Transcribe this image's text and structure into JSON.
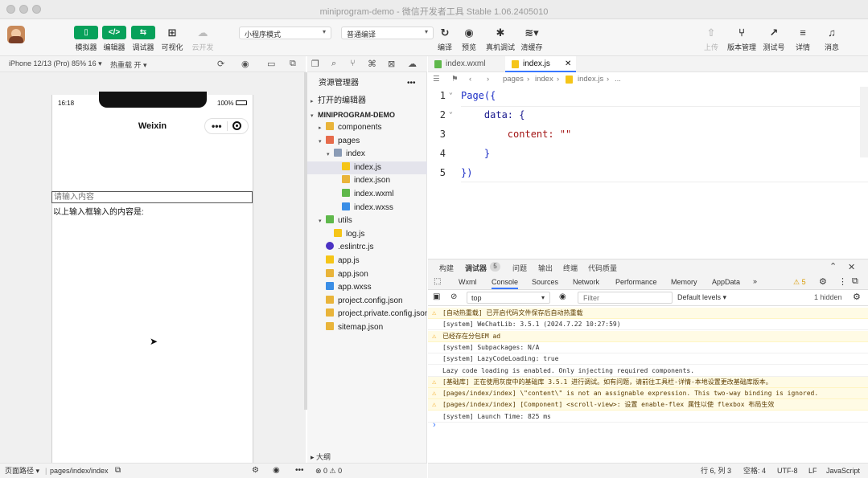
{
  "window": {
    "title": "miniprogram-demo - 微信开发者工具 Stable 1.06.2405010"
  },
  "toolbar": {
    "left_buttons": [
      {
        "label": "模拟器",
        "icon": "phone-icon"
      },
      {
        "label": "编辑器",
        "icon": "code-icon"
      },
      {
        "label": "调试器",
        "icon": "debug-icon"
      },
      {
        "label": "可视化",
        "icon": "layout-icon"
      },
      {
        "label": "云开发",
        "icon": "cloud-icon"
      }
    ],
    "mode_select": "小程序模式",
    "compile_select": "普通编译",
    "mid_buttons": [
      {
        "label": "编译",
        "icon": "refresh-icon"
      },
      {
        "label": "预览",
        "icon": "eye-icon"
      },
      {
        "label": "真机调试",
        "icon": "bug-icon"
      },
      {
        "label": "清缓存",
        "icon": "layers-icon"
      }
    ],
    "right_buttons": [
      {
        "label": "上传",
        "icon": "upload-icon"
      },
      {
        "label": "版本管理",
        "icon": "branch-icon"
      },
      {
        "label": "测试号",
        "icon": "chart-icon"
      },
      {
        "label": "详情",
        "icon": "menu-icon"
      },
      {
        "label": "消息",
        "icon": "bell-icon"
      }
    ]
  },
  "simulator": {
    "device": "iPhone 12/13 (Pro) 85% 16 ▾",
    "hot_reload": "热重载 开 ▾",
    "time": "16:18",
    "battery": "100%",
    "nav_title": "Weixin",
    "input_placeholder": "请输入内容",
    "output_text": "以上输入框输入的内容是:",
    "page_path_label": "页面路径 ▾",
    "page_path": "pages/index/index"
  },
  "explorer": {
    "title": "资源管理器",
    "open_editors": "打开的编辑器",
    "project": "MINIPROGRAM-DEMO",
    "items": [
      {
        "name": "components",
        "arrow": "▸",
        "icon": "folder",
        "color": "#e9b43a"
      },
      {
        "name": "pages",
        "arrow": "▾",
        "icon": "folder",
        "color": "#e66b4b"
      },
      {
        "name": "index",
        "arrow": "▾",
        "icon": "folder",
        "color": "#8a9bb5"
      },
      {
        "name": "index.js",
        "arrow": "",
        "icon": "js",
        "color": "#f5c518"
      },
      {
        "name": "index.json",
        "arrow": "",
        "icon": "json",
        "color": "#e9b43a"
      },
      {
        "name": "index.wxml",
        "arrow": "",
        "icon": "wxml",
        "color": "#5fb84b"
      },
      {
        "name": "index.wxss",
        "arrow": "",
        "icon": "wxss",
        "color": "#3a8ee6"
      },
      {
        "name": "utils",
        "arrow": "▾",
        "icon": "folder",
        "color": "#5fb84b"
      },
      {
        "name": "log.js",
        "arrow": "",
        "icon": "js",
        "color": "#f5c518"
      },
      {
        "name": ".eslintrc.js",
        "arrow": "",
        "icon": "eslint",
        "color": "#4b32c3"
      },
      {
        "name": "app.js",
        "arrow": "",
        "icon": "js",
        "color": "#f5c518"
      },
      {
        "name": "app.json",
        "arrow": "",
        "icon": "json",
        "color": "#e9b43a"
      },
      {
        "name": "app.wxss",
        "arrow": "",
        "icon": "wxss",
        "color": "#3a8ee6"
      },
      {
        "name": "project.config.json",
        "arrow": "",
        "icon": "json",
        "color": "#e9b43a"
      },
      {
        "name": "project.private.config.json",
        "arrow": "",
        "icon": "json",
        "color": "#e9b43a"
      },
      {
        "name": "sitemap.json",
        "arrow": "",
        "icon": "json",
        "color": "#e9b43a"
      }
    ],
    "outline": "大纲",
    "counts": "⊗ 0 ⚠ 0"
  },
  "editor": {
    "tabs": [
      {
        "name": "index.wxml",
        "icon": "wxml"
      },
      {
        "name": "index.js",
        "icon": "js"
      }
    ],
    "breadcrumb": [
      "pages",
      "index",
      "index.js",
      "..."
    ],
    "lines": [
      {
        "num": "1",
        "text": "Page({"
      },
      {
        "num": "2",
        "text": "    data: {"
      },
      {
        "num": "3",
        "text": "        content: \"\""
      },
      {
        "num": "4",
        "text": "    }"
      },
      {
        "num": "5",
        "text": "})"
      }
    ],
    "status": {
      "position": "行 6, 列 3",
      "spaces": "空格: 4",
      "encoding": "UTF-8",
      "eol": "LF",
      "language": "JavaScript"
    }
  },
  "debugger": {
    "top_tabs": [
      "构建",
      "调试器",
      "问题",
      "输出",
      "终端",
      "代码质量"
    ],
    "badge": "5",
    "dev_tabs": [
      "Wxml",
      "Console",
      "Sources",
      "Network",
      "Performance",
      "Memory",
      "AppData",
      "»"
    ],
    "warnings": "⚠ 5",
    "context": "top",
    "filter_placeholder": "Filter",
    "levels": "Default levels ▾",
    "hidden": "1 hidden",
    "logs": [
      {
        "type": "warn",
        "text": "[自动热重载] 已开启代码文件保存后自动热重载"
      },
      {
        "type": "info",
        "text": "[system] WeChatLib: 3.5.1 (2024.7.22 10:27:59)"
      },
      {
        "type": "warn",
        "text": "已经存在分包EM ad"
      },
      {
        "type": "info",
        "text": "[system] Subpackages: N/A"
      },
      {
        "type": "info",
        "text": "[system] LazyCodeLoading: true"
      },
      {
        "type": "info",
        "text": "Lazy code loading is enabled. Only injecting required components."
      },
      {
        "type": "warn",
        "text": "[基础库] 正在使用灰度中的基础库 3.5.1 进行调试。如有问题，请前往工具栏-详情-本地设置更改基础库版本。"
      },
      {
        "type": "warn",
        "text": "[pages/index/index] \\\"content\\\" is not an assignable expression. This two-way binding is ignored."
      },
      {
        "type": "warn",
        "text": "[pages/index/index] [Component] <scroll-view>: 设置 enable-flex 属性以使 flexbox 布局生效"
      },
      {
        "type": "info",
        "text": "[system] Launch Time: 825 ms"
      }
    ],
    "prompt": "›"
  }
}
